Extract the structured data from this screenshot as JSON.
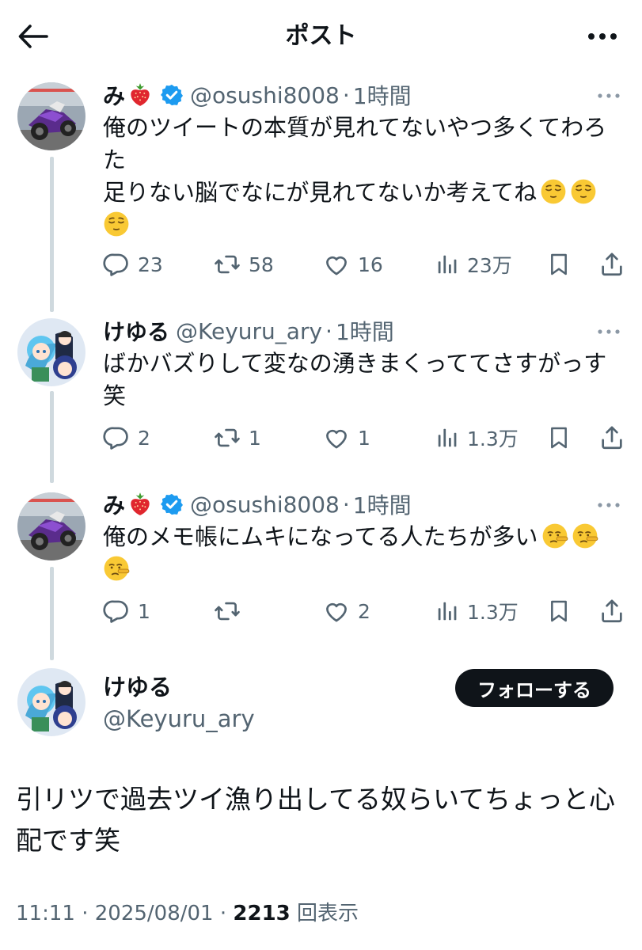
{
  "header": {
    "back_icon": "arrow-left-icon",
    "title": "ポスト",
    "more_icon": "ellipsis-icon"
  },
  "replies": [
    {
      "name": "み",
      "name_emoji": "strawberry",
      "verified": true,
      "handle": "@osushi8008",
      "separator": "·",
      "time": "1時間",
      "lines": [
        "俺のツイートの本質が見れてないやつ多くてわろ",
        "た",
        "足りない脳でなにが見れてないか考えてね"
      ],
      "trailing_emoji": "relieved-face",
      "counts": {
        "replies": "23",
        "reposts": "58",
        "likes": "16",
        "views": "23万"
      }
    },
    {
      "name": "けゆる",
      "verified": false,
      "handle": "@Keyuru_ary",
      "separator": "·",
      "time": "1時間",
      "lines": [
        "ばかバズりして変なの湧きまくっててさすがっす",
        "笑"
      ],
      "counts": {
        "replies": "2",
        "reposts": "1",
        "likes": "1",
        "views": "1.3万"
      }
    },
    {
      "name": "み",
      "name_emoji": "strawberry",
      "verified": true,
      "handle": "@osushi8008",
      "separator": "·",
      "time": "1時間",
      "lines": [
        "俺のメモ帳にムキになってる人たちが多い"
      ],
      "trailing_emoji": "lying-face",
      "counts": {
        "replies": "1",
        "reposts": "",
        "likes": "2",
        "views": "1.3万"
      }
    }
  ],
  "main": {
    "name": "けゆる",
    "handle": "@Keyuru_ary",
    "follow_label": "フォローする",
    "text": "引リツで過去ツイ漁り出してる奴らいてちょっと心配です笑",
    "time": "11:11",
    "date": "2025/08/01",
    "separator": "·",
    "views": "2213",
    "views_label": "回表示"
  },
  "colors": {
    "text": "#0f1419",
    "muted": "#536471",
    "verified": "#1d9bf0",
    "line": "#cfd9de",
    "follow_bg": "#0f1419"
  }
}
